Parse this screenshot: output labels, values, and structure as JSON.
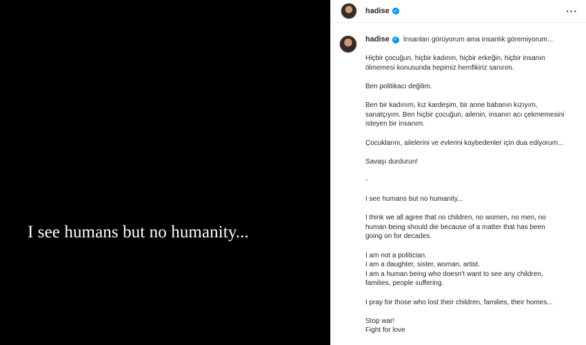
{
  "media": {
    "text": "I see humans but no humanity..."
  },
  "header": {
    "username": "hadise",
    "more_icon": "more-horizontal-icon"
  },
  "caption": {
    "username": "hadise",
    "intro": "İnsanları görüyorum ama insanlık göremiyorum...",
    "paragraphs": [
      [
        "Hiçbir çocuğun, hiçbir kadının, hiçbir erkeğin, hiçbir insanın",
        "ölmemesi konusunda hepimiz hemfikiriz sanırım."
      ],
      [
        "Ben politikacı değilim."
      ],
      [
        "Ben bir kadınım, kız kardeşim, bir anne babanın kızıyım,",
        "sanatçıyım. Ben hiçbir çocuğun, ailenin, insanın acı çekmemesini",
        "isteyen bir insanım."
      ],
      [
        "Çocuklarını, ailelerini ve evlerini kaybedenler için dua ediyorum..."
      ],
      [
        "Savaşı durdurun!"
      ],
      [
        "-"
      ],
      [
        "I see humans but no humanity..."
      ],
      [
        "I think we all agree that no children, no women, no men, no",
        "human being should die because of a matter that has been",
        "going on for decades."
      ],
      [
        "I am not a politician.",
        "I am a daughter, sister, woman, artist.",
        "I am a human being who doesn't want to see any children,",
        "families, people suffering."
      ],
      [
        "I pray for those who lost their children, families, their homes..."
      ],
      [
        "Stop war!",
        "Fight for love"
      ]
    ]
  }
}
